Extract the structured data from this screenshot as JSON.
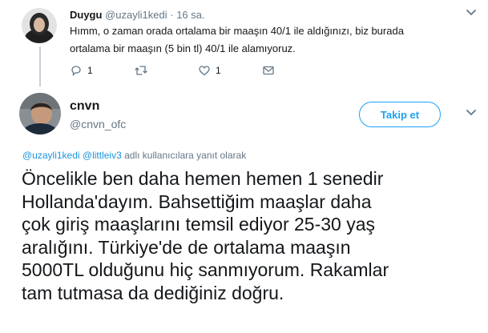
{
  "reply_tweet": {
    "author_name": "Duygu",
    "author_handle": "@uzayli1kedi",
    "separator": "·",
    "timestamp": "16 sa.",
    "text_line1": "Hımm, o zaman orada ortalama bir maaşın 40/1 ile aldığınızı, biz burada",
    "text_line2": "ortalama bir maaşın (5 bin tl) 40/1 ile alamıyoruz.",
    "reply_count": "1",
    "retweet_count": "",
    "like_count": "1"
  },
  "main_tweet": {
    "author_name": "cnvn",
    "author_handle": "@cnvn_ofc",
    "follow_label": "Takip et",
    "reply_mention_1": "@uzayli1kedi",
    "reply_mention_2": "@littleiv3",
    "reply_suffix": " adlı kullanıcılara yanıt olarak",
    "text_lines": [
      "Öncelikle ben daha hemen hemen 1 senedir",
      "Hollanda'dayım. Bahsettiğim maaşlar daha",
      "çok giriş maaşlarını temsil ediyor 25-30 yaş",
      "aralığını. Türkiye'de de ortalama maaşın",
      "5000TL olduğunu hiç sanmıyorum. Rakamlar",
      "tam tutmasa da dediğiniz doğru."
    ]
  },
  "colors": {
    "accent": "#1da1f2",
    "secondary_text": "#657786",
    "primary_text": "#14171a"
  }
}
